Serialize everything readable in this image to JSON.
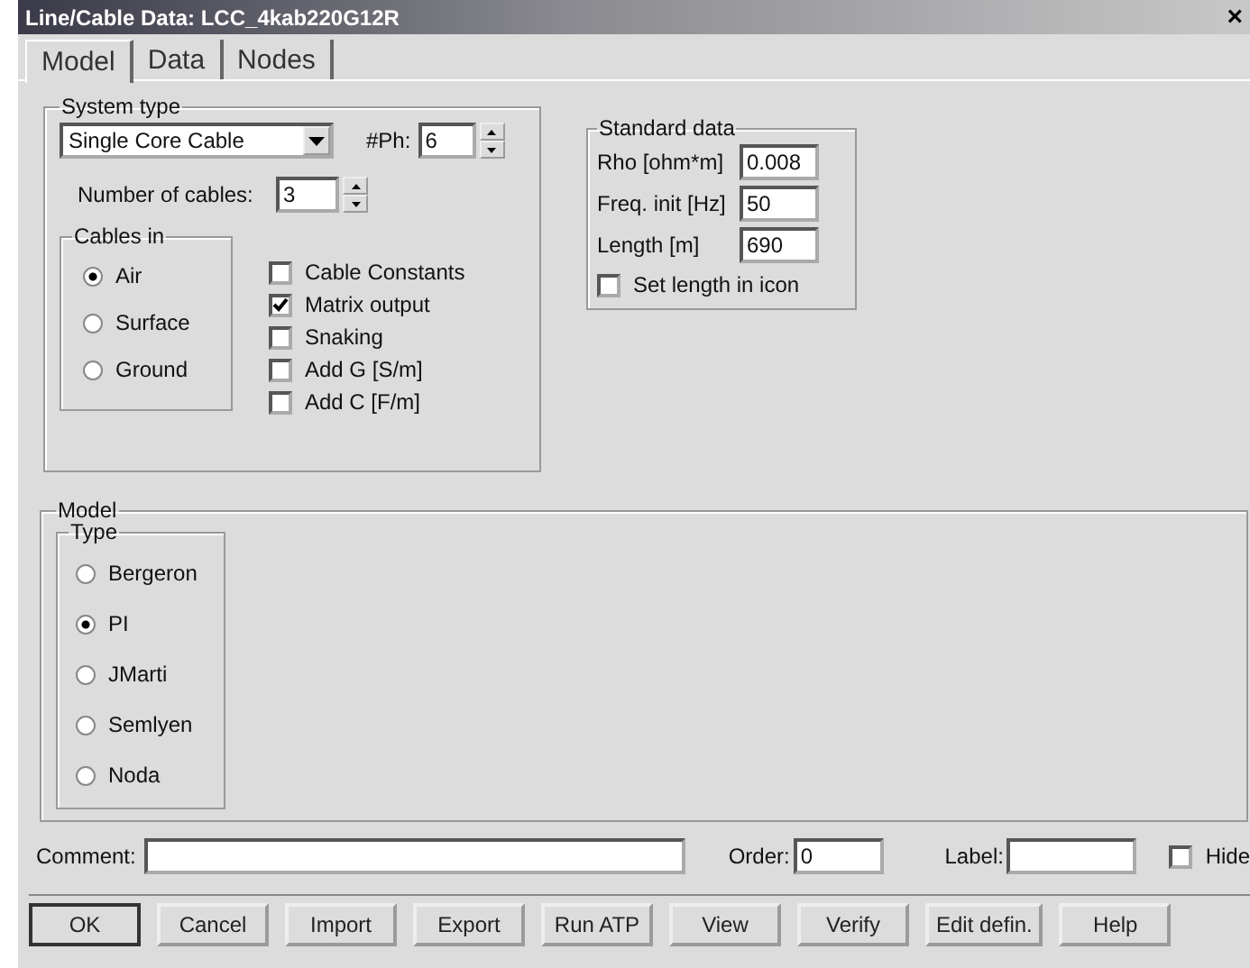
{
  "window": {
    "title": "Line/Cable Data: LCC_4kab220G12R",
    "close": "×"
  },
  "tabs": [
    {
      "label": "Model",
      "selected": true
    },
    {
      "label": "Data",
      "selected": false
    },
    {
      "label": "Nodes",
      "selected": false
    }
  ],
  "system_type": {
    "title": "System type",
    "dropdown": {
      "value": "Single Core Cable"
    },
    "phases": {
      "label": "#Ph:",
      "value": "6"
    },
    "cables": {
      "label": "Number of cables:",
      "value": "3"
    },
    "cables_in": {
      "title": "Cables in",
      "options": [
        {
          "label": "Air",
          "selected": true
        },
        {
          "label": "Surface",
          "selected": false
        },
        {
          "label": "Ground",
          "selected": false
        }
      ]
    },
    "options": [
      {
        "label": "Cable Constants",
        "checked": false
      },
      {
        "label": "Matrix output",
        "checked": true
      },
      {
        "label": "Snaking",
        "checked": false
      },
      {
        "label": "Add G [S/m]",
        "checked": false
      },
      {
        "label": "Add C [F/m]",
        "checked": false
      }
    ]
  },
  "standard_data": {
    "title": "Standard data",
    "fields": [
      {
        "label": "Rho [ohm*m]",
        "value": "0.008"
      },
      {
        "label": "Freq. init [Hz]",
        "value": "50"
      },
      {
        "label": "Length [m]",
        "value": "690"
      }
    ],
    "set_length": {
      "label": "Set length in icon",
      "checked": false
    }
  },
  "model": {
    "title": "Model",
    "type": {
      "title": "Type",
      "options": [
        {
          "label": "Bergeron",
          "selected": false
        },
        {
          "label": "PI",
          "selected": true
        },
        {
          "label": "JMarti",
          "selected": false
        },
        {
          "label": "Semlyen",
          "selected": false
        },
        {
          "label": "Noda",
          "selected": false
        }
      ]
    }
  },
  "footer": {
    "comment": {
      "label": "Comment:"
    },
    "order": {
      "label": "Order:",
      "value": "0"
    },
    "label_field": {
      "label": "Label:"
    },
    "hide": {
      "label": "Hide",
      "checked": false
    }
  },
  "buttons": [
    "OK",
    "Cancel",
    "Import",
    "Export",
    "Run ATP",
    "View",
    "Verify",
    "Edit defin.",
    "Help"
  ]
}
